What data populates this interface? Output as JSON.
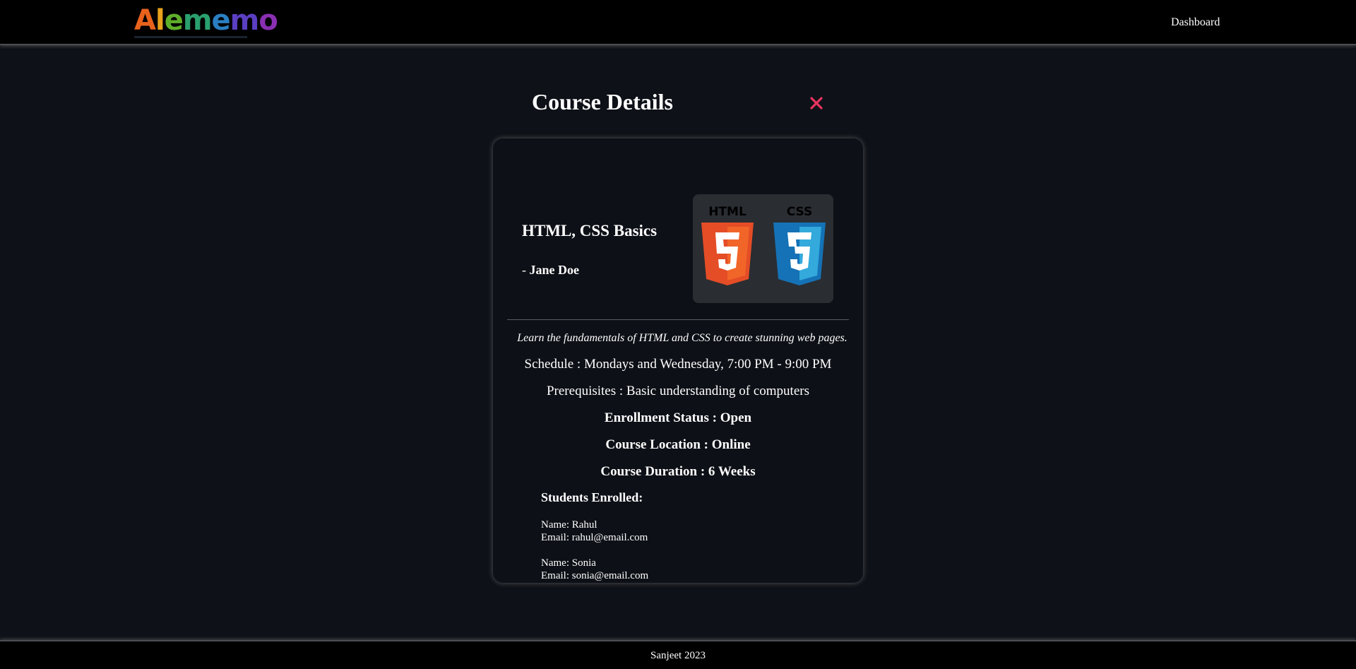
{
  "navbar": {
    "logo_text": "Alememo",
    "dashboard_label": "Dashboard"
  },
  "modal": {
    "title": "Course Details",
    "close_icon": "close-icon",
    "close_color": "#e8345f"
  },
  "course": {
    "name": "HTML, CSS Basics",
    "instructor_prefix": "- ",
    "instructor": "Jane Doe",
    "thumbnail_icons": [
      "html5-logo",
      "css3-logo"
    ],
    "thumbnail_text": [
      "HTML",
      "CSS"
    ],
    "description": "Learn the fundamentals of HTML and CSS to create stunning web pages.",
    "schedule": "Schedule : Mondays and Wednesday, 7:00 PM - 9:00 PM",
    "prerequisites": "Prerequisites : Basic understanding of computers",
    "enrollment_status": "Enrollment Status : Open",
    "location": "Course Location : Online",
    "duration": "Course Duration : 6 Weeks",
    "students_heading": "Students Enrolled:",
    "students": [
      {
        "name": "Name: Rahul",
        "email": "Email: rahul@email.com"
      },
      {
        "name": "Name: Sonia",
        "email": "Email: sonia@email.com"
      }
    ]
  },
  "footer": {
    "text": "Sanjeet 2023"
  },
  "colors": {
    "background": "#0e1117",
    "bar": "#000000",
    "card": "#0d1016",
    "html5_orange": "#e44d26",
    "css3_blue": "#1572b6"
  }
}
